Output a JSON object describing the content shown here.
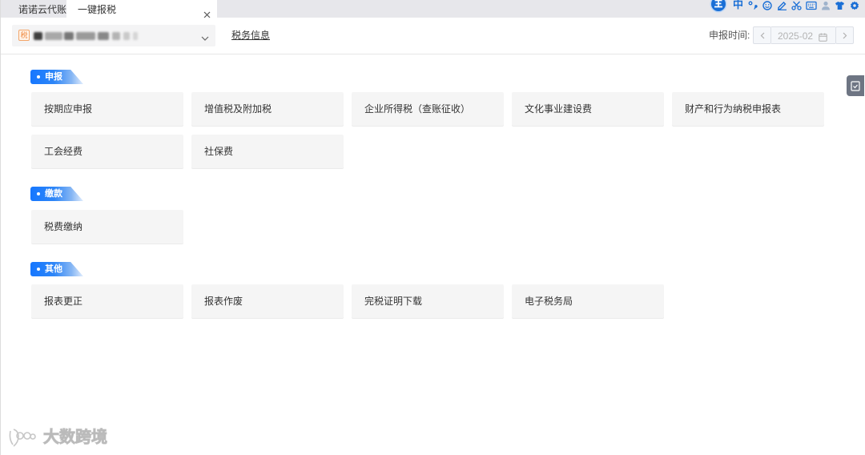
{
  "tabs": [
    {
      "label": "诺诺云代账",
      "active": false
    },
    {
      "label": "一键报税",
      "active": true
    }
  ],
  "ime_toolbar": {
    "mode_label": "中",
    "icons": [
      "ime-logo-icon",
      "punctuation-icon",
      "emoji-icon",
      "handwriting-icon",
      "scissors-icon",
      "soft-keyboard-icon",
      "user-icon",
      "skin-icon",
      "settings-icon"
    ]
  },
  "header": {
    "company_badge": "税",
    "tax_info_link": "税务信息",
    "period_label": "申报时间:",
    "period_value": "2025-02"
  },
  "sections": [
    {
      "title": "申报",
      "items": [
        "按期应申报",
        "增值税及附加税",
        "企业所得税（查账征收）",
        "文化事业建设费",
        "财产和行为纳税申报表",
        "工会经费",
        "社保费"
      ]
    },
    {
      "title": "缴款",
      "items": [
        "税费缴纳"
      ]
    },
    {
      "title": "其他",
      "items": [
        "报表更正",
        "报表作废",
        "完税证明下载",
        "电子税务局"
      ]
    }
  ],
  "side_tool": {
    "icon": "document-check-icon"
  },
  "watermark": {
    "text": "大数跨境"
  },
  "theme": {
    "accent": "#1677ff",
    "ime_blue": "#1a6fd6",
    "card_bg": "#f5f5f5",
    "badge_orange": "#f0883e",
    "side_tool_bg": "#6e7583"
  }
}
